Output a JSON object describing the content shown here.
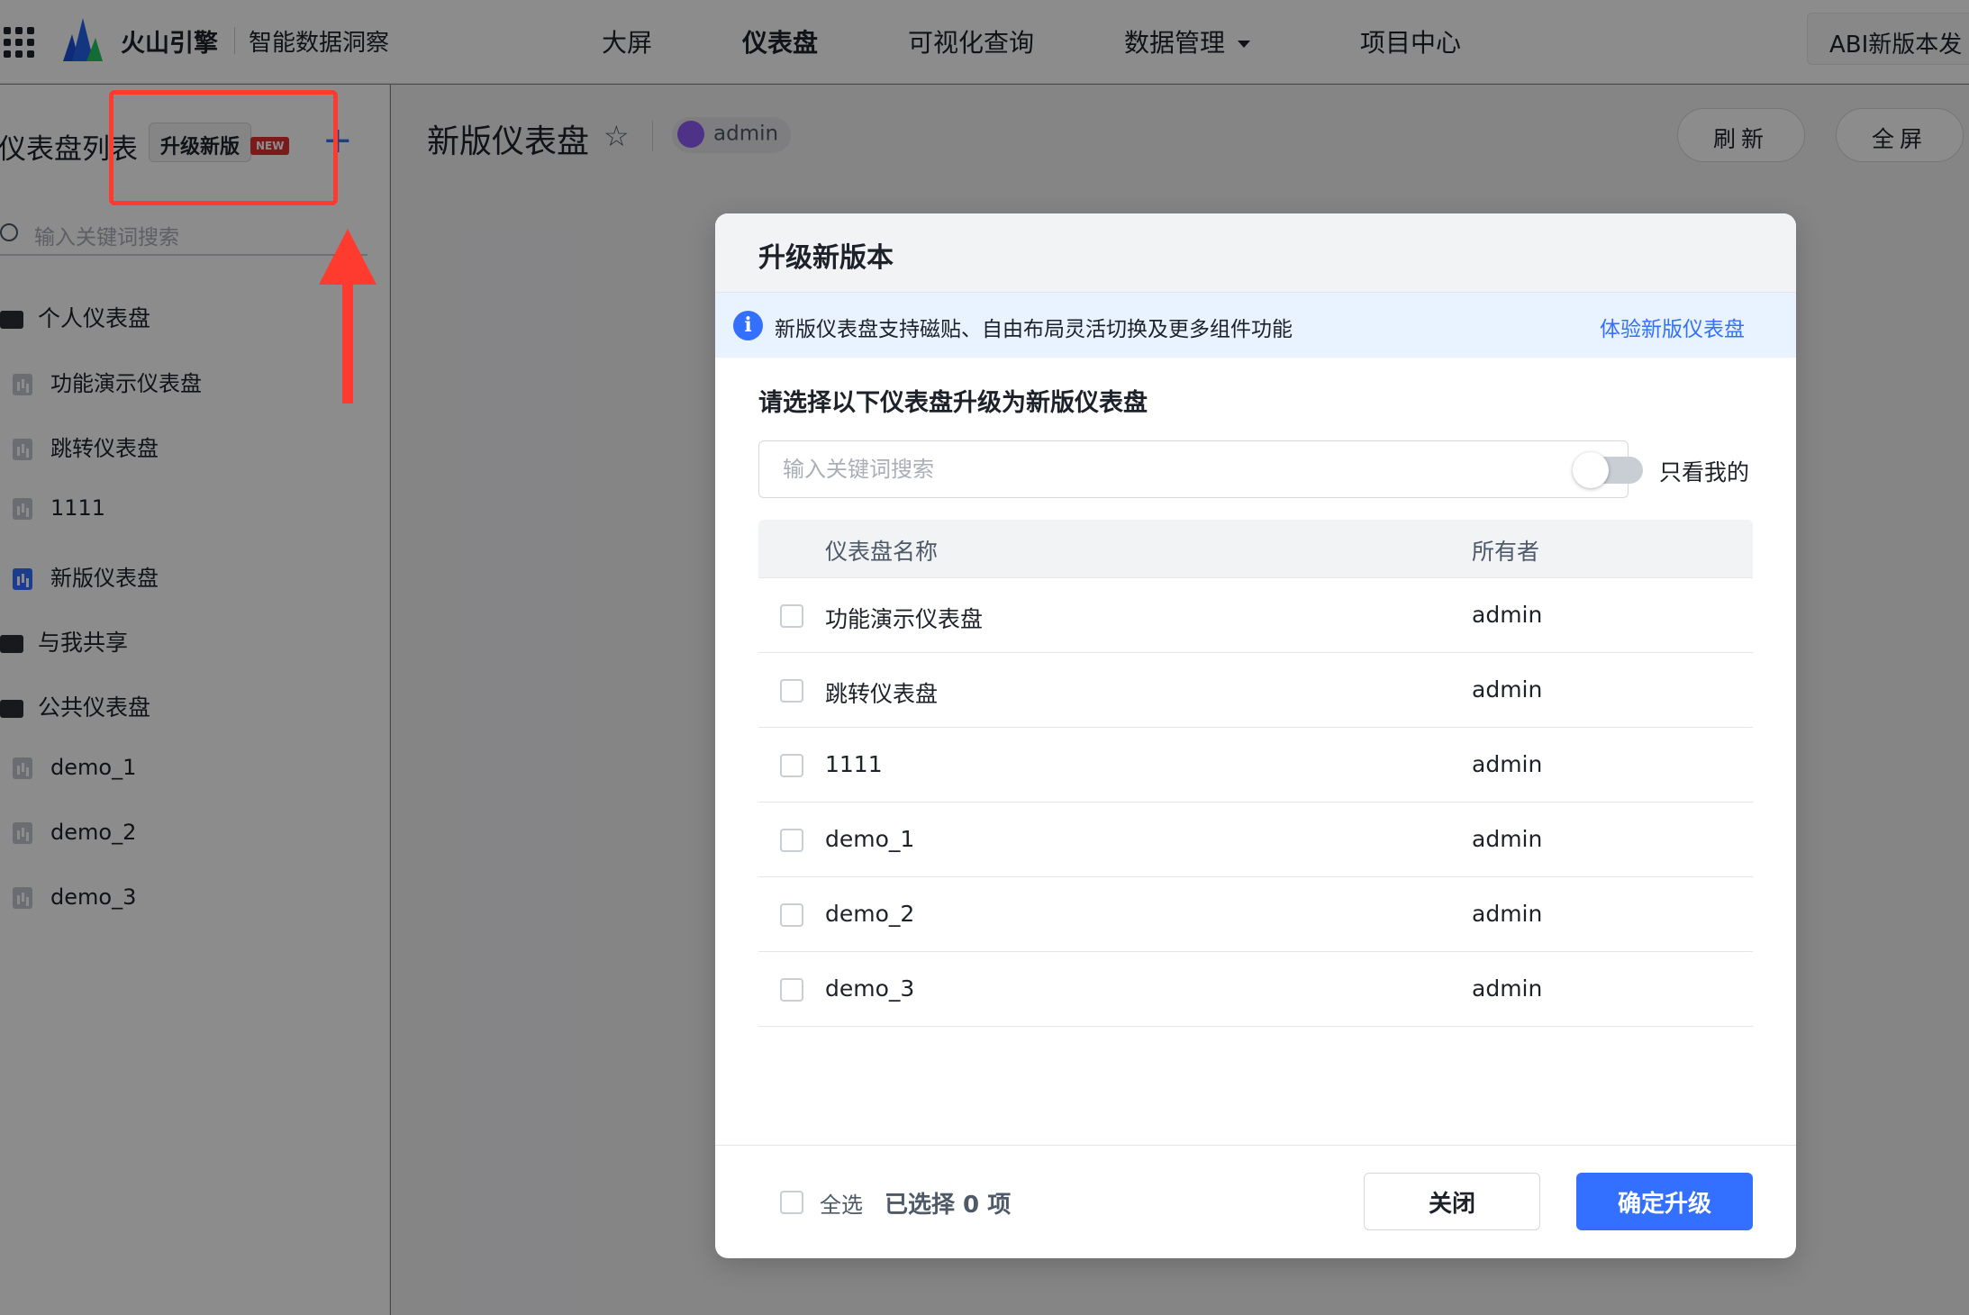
{
  "topbar": {
    "brand": "火山引擎",
    "subbrand": "智能数据洞察",
    "nav": [
      "大屏",
      "仪表盘",
      "可视化查询",
      "数据管理",
      "项目中心"
    ],
    "active_nav": "仪表盘",
    "version_button": "ABI新版本发"
  },
  "sidebar": {
    "title": "仪表盘列表",
    "upgrade_chip": "升级新版",
    "new_badge": "NEW",
    "add_icon": "+",
    "search_placeholder": "输入关键词搜索",
    "groups": [
      {
        "label": "个人仪表盘",
        "items": [
          "功能演示仪表盘",
          "跳转仪表盘",
          "1111",
          "新版仪表盘"
        ]
      },
      {
        "label": "与我共享",
        "items": []
      },
      {
        "label": "公共仪表盘",
        "items": [
          "demo_1",
          "demo_2",
          "demo_3"
        ]
      }
    ]
  },
  "main": {
    "dashboard_title": "新版仪表盘",
    "star_icon": "☆",
    "owner": "admin",
    "refresh_button": "刷新",
    "fullscreen_button": "全屏"
  },
  "modal": {
    "title": "升级新版本",
    "info_text": "新版仪表盘支持磁贴、自由布局灵活切换及更多组件功能",
    "info_link": "体验新版仪表盘",
    "section_label": "请选择以下仪表盘升级为新版仪表盘",
    "search_placeholder": "输入关键词搜索",
    "toggle_label": "只看我的",
    "columns": {
      "name": "仪表盘名称",
      "owner": "所有者"
    },
    "rows": [
      {
        "name": "功能演示仪表盘",
        "owner": "admin"
      },
      {
        "name": "跳转仪表盘",
        "owner": "admin"
      },
      {
        "name": "1111",
        "owner": "admin"
      },
      {
        "name": "demo_1",
        "owner": "admin"
      },
      {
        "name": "demo_2",
        "owner": "admin"
      },
      {
        "name": "demo_3",
        "owner": "admin"
      }
    ],
    "select_all": "全选",
    "selected_count": "已选择 0 项",
    "close_button": "关闭",
    "confirm_button": "确定升级"
  },
  "colors": {
    "accent": "#3370ff",
    "highlight": "#ff3b30",
    "badge": "#e03131"
  }
}
